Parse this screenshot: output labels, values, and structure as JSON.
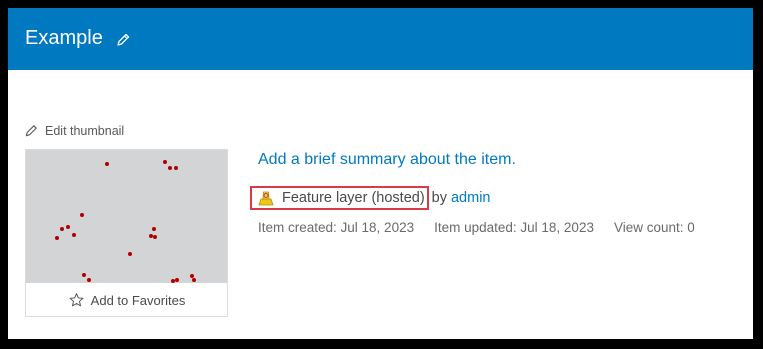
{
  "header": {
    "title": "Example",
    "edit_icon": "pencil-icon"
  },
  "thumbnail": {
    "edit_label": "Edit thumbnail",
    "edit_icon": "pencil-icon",
    "favorites_label": "Add to Favorites",
    "favorites_icon": "star-icon"
  },
  "details": {
    "summary_placeholder": "Add a brief summary about the item.",
    "type_label": "Feature layer (hosted)",
    "type_icon": "feature-layer-icon",
    "by_label": "by",
    "owner": "admin",
    "created": "Item created: Jul 18, 2023",
    "updated": "Item updated: Jul 18, 2023",
    "view_count": "View count: 0"
  },
  "colors": {
    "header_bg": "#0079c1",
    "link": "#0079c1",
    "highlight_border": "#d83b45",
    "map_point": "#b00000",
    "thumbnail_bg": "#d2d4d6"
  }
}
